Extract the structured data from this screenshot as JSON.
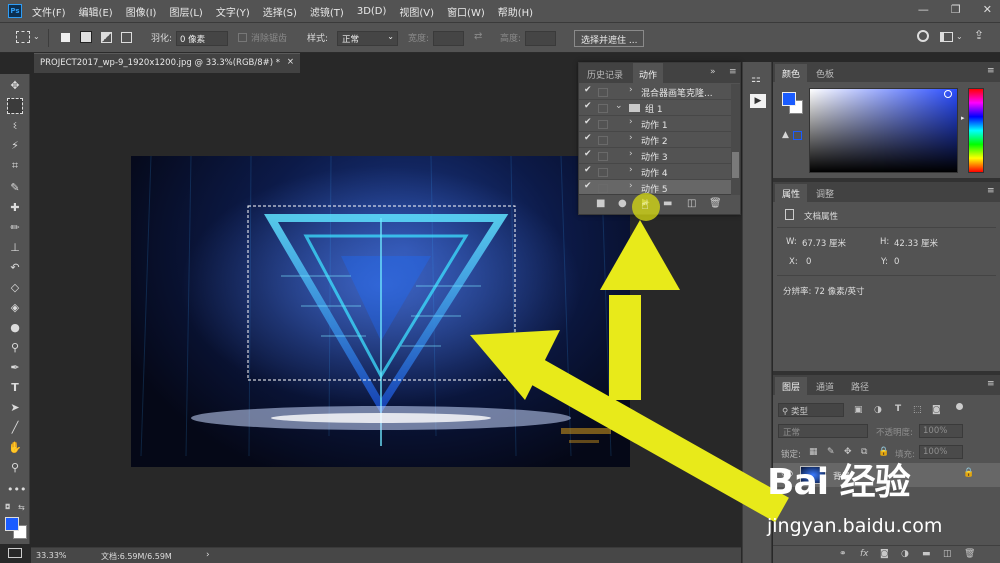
{
  "app": {
    "logo_text": "Ps"
  },
  "menu": [
    "文件(F)",
    "编辑(E)",
    "图像(I)",
    "图层(L)",
    "文字(Y)",
    "选择(S)",
    "滤镜(T)",
    "3D(D)",
    "视图(V)",
    "窗口(W)",
    "帮助(H)"
  ],
  "window_controls": {
    "minimize": "—",
    "restore": "❐",
    "close": "✕"
  },
  "options": {
    "feather_label": "羽化:",
    "feather_value": "0 像素",
    "antialias_label": "消除锯齿",
    "style_label": "样式:",
    "style_value": "正常",
    "width_label": "宽度:",
    "height_label": "高度:",
    "select_mask_button": "选择并遮住 ..."
  },
  "document": {
    "tab_title": "PROJECT2017_wp-9_1920x1200.jpg @ 33.3%(RGB/8#) *",
    "tab_close": "×",
    "zoom": "33.33%",
    "doc_info": "文档:6.59M/6.59M"
  },
  "actions_panel": {
    "tabs": [
      "历史记录",
      "动作"
    ],
    "active_tab": "动作",
    "rows": [
      {
        "label": "混合器画笔克隆...",
        "indent": 0,
        "type": "set"
      },
      {
        "label": "组 1",
        "indent": 1,
        "type": "folder"
      },
      {
        "label": "动作 1",
        "indent": 2,
        "type": "action"
      },
      {
        "label": "动作 2",
        "indent": 2,
        "type": "action"
      },
      {
        "label": "动作 3",
        "indent": 2,
        "type": "action"
      },
      {
        "label": "动作 4",
        "indent": 2,
        "type": "action"
      },
      {
        "label": "动作 5",
        "indent": 2,
        "type": "action"
      }
    ]
  },
  "color_panel": {
    "tabs": [
      "颜色",
      "色板"
    ],
    "active_tab": "颜色"
  },
  "properties_panel": {
    "tabs": [
      "属性",
      "调整"
    ],
    "active_tab": "属性",
    "title": "文档属性",
    "w_label": "W:",
    "w_value": "67.73 厘米",
    "h_label": "H:",
    "h_value": "42.33 厘米",
    "x_label": "X:",
    "x_value": "0",
    "y_label": "Y:",
    "y_value": "0",
    "resolution": "分辨率: 72 像素/英寸"
  },
  "layers_panel": {
    "tabs": [
      "图层",
      "通道",
      "路径"
    ],
    "active_tab": "图层",
    "filter_label": "类型",
    "blend_mode": "正常",
    "opacity_label": "不透明度:",
    "opacity_value": "100%",
    "lock_label": "锁定:",
    "fill_label": "填充:",
    "fill_value": "100%",
    "layer_name": "背景"
  },
  "watermark": {
    "logo": "Bai 经验",
    "url": "jingyan.baidu.com"
  },
  "colors": {
    "foreground": "#1a5cff",
    "background": "#ffffff",
    "arrow": "#e8ea1a",
    "accent_blue": "#1a5cff"
  }
}
